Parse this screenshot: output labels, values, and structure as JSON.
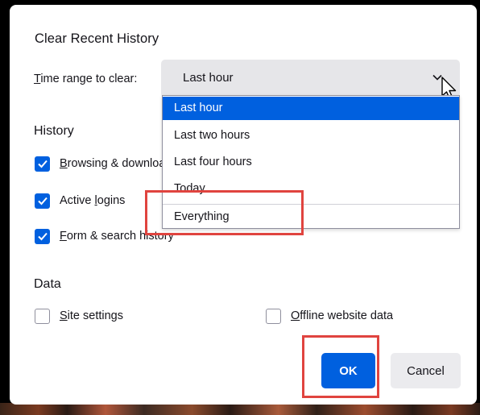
{
  "dialog": {
    "title": "Clear Recent History",
    "time_range": {
      "label_first_char": "T",
      "label_rest": "ime range to clear:",
      "selected_value": "Last hour",
      "chevron_icon": "chevron-down-icon"
    },
    "dropdown": {
      "options": [
        {
          "label": "Last hour",
          "selected": true
        },
        {
          "label": "Last two hours",
          "selected": false
        },
        {
          "label": "Last four hours",
          "selected": false
        },
        {
          "label": "Today",
          "selected": false
        },
        {
          "label": "Everything",
          "selected": false
        }
      ]
    },
    "history": {
      "heading": "History",
      "items": [
        {
          "access_key": "B",
          "label_rest": "rowsing & download history",
          "checked": true
        },
        {
          "access_key": "",
          "label_pre": "Active ",
          "access_key_inner": "l",
          "label_rest": "ogins",
          "checked": true
        },
        {
          "access_key": "F",
          "label_rest": "orm & search history",
          "checked": true
        }
      ]
    },
    "data": {
      "heading": "Data",
      "items": [
        {
          "access_key": "S",
          "label_rest": "ite settings",
          "checked": false
        },
        {
          "access_key": "O",
          "label_rest": "ffline website data",
          "checked": false
        }
      ]
    },
    "buttons": {
      "ok_label": "OK",
      "cancel_label": "Cancel"
    }
  },
  "colors": {
    "accent": "#0060df",
    "highlight": "#e0443f",
    "select_bg": "#e6e6e9"
  }
}
